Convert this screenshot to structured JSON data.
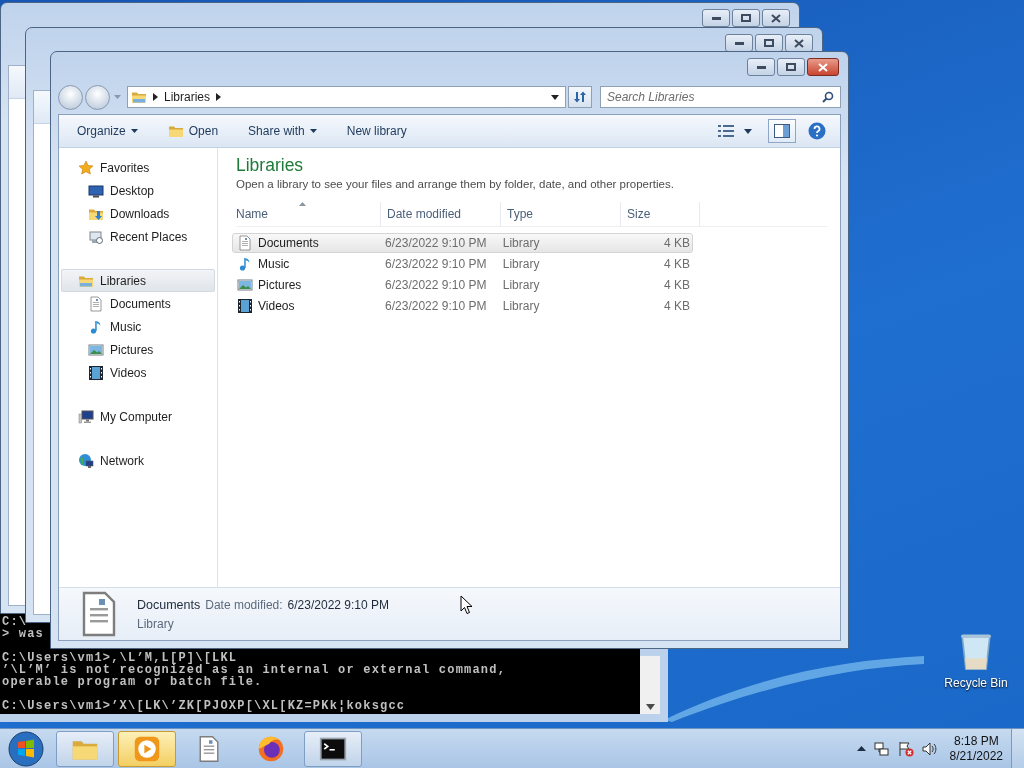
{
  "desktop": {
    "icons": [
      {
        "label": "Recycle Bin"
      }
    ]
  },
  "console": {
    "blocks": [
      [
        "C:\\",
        "> was"
      ],
      [
        "C:\\Users\\vm1>,\\L’M,L[P]\\[LKL",
        "’\\L’M’ is not recognized as an internal or external command,",
        "operable program or batch file."
      ],
      [
        "C:\\Users\\vm1>’X\\[LK\\’ZK[PJOXP[\\XL[KZ=PKk¦koksgcc"
      ]
    ]
  },
  "explorer": {
    "crumbs": [
      "Libraries"
    ],
    "search": {
      "placeholder": "Search Libraries"
    },
    "toolbar": [
      {
        "label": "Organize",
        "kind": "menu"
      },
      {
        "label": "Open",
        "kind": "open"
      },
      {
        "label": "Share with",
        "kind": "menu"
      },
      {
        "label": "New library",
        "kind": "action"
      }
    ],
    "nav": [
      {
        "label": "Favorites",
        "kind": "star",
        "selected": false,
        "children": [
          {
            "label": "Desktop",
            "kind": "desktop",
            "selected": false
          },
          {
            "label": "Downloads",
            "kind": "downloads",
            "selected": false
          },
          {
            "label": "Recent Places",
            "kind": "recent",
            "selected": false
          }
        ]
      },
      {
        "label": "Libraries",
        "kind": "library",
        "selected": true,
        "children": [
          {
            "label": "Documents",
            "kind": "document",
            "selected": false
          },
          {
            "label": "Music",
            "kind": "music",
            "selected": false
          },
          {
            "label": "Pictures",
            "kind": "pictures",
            "selected": false
          },
          {
            "label": "Videos",
            "kind": "videos",
            "selected": false
          }
        ]
      },
      {
        "label": "My Computer",
        "kind": "computer",
        "selected": false
      },
      {
        "label": "Network",
        "kind": "network",
        "selected": false
      }
    ],
    "heading": "Libraries",
    "subtitle": "Open a library to see your files and arrange them by folder, date, and other properties.",
    "columns": [
      {
        "label": "Name",
        "sorted": true
      },
      {
        "label": "Date modified",
        "sorted": false
      },
      {
        "label": "Type",
        "sorted": false
      },
      {
        "label": "Size",
        "sorted": false
      }
    ],
    "rows": [
      {
        "name": "Documents",
        "kind": "document",
        "date": "6/23/2022 9:10 PM",
        "type": "Library",
        "size": "4 KB",
        "selected": true
      },
      {
        "name": "Music",
        "kind": "music",
        "date": "6/23/2022 9:10 PM",
        "type": "Library",
        "size": "4 KB",
        "selected": false
      },
      {
        "name": "Pictures",
        "kind": "pictures",
        "date": "6/23/2022 9:10 PM",
        "type": "Library",
        "size": "4 KB",
        "selected": false
      },
      {
        "name": "Videos",
        "kind": "videos",
        "date": "6/23/2022 9:10 PM",
        "type": "Library",
        "size": "4 KB",
        "selected": false
      }
    ],
    "details": {
      "name": "Documents",
      "kind": "document",
      "date_label": "Date modified:",
      "date": "6/23/2022 9:10 PM",
      "type": "Library"
    }
  },
  "taskbar": {
    "items": [
      {
        "kind": "folder",
        "running": true,
        "flashing": false
      },
      {
        "kind": "media",
        "running": true,
        "flashing": true
      },
      {
        "kind": "document",
        "running": false,
        "flashing": false
      },
      {
        "kind": "firefox",
        "running": false,
        "flashing": false
      },
      {
        "kind": "console",
        "running": true,
        "flashing": false
      }
    ],
    "time": "8:18 PM",
    "date": "8/21/2022"
  }
}
